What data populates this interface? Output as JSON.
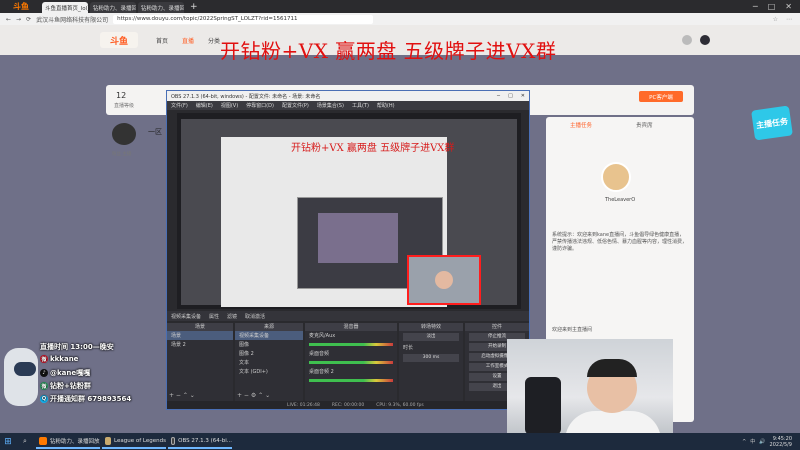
{
  "browser": {
    "brand": "斗鱼",
    "tabs": [
      {
        "label": "斗鱼直播首页_lol直播_英雄联盟直播",
        "active": true
      },
      {
        "label": "钻粉助力、录播回放",
        "active": false
      },
      {
        "label": "钻粉助力、录播回放、斗鱼直播平台",
        "active": false
      }
    ],
    "new_tab": "+",
    "window_controls": [
      "─",
      "□",
      "✕"
    ],
    "nav_buttons": [
      "←",
      "→",
      "⟳"
    ],
    "site_label": "武汉斗鱼网络科技有限公司",
    "url": "https://www.douyu.com/topic/2022SpringST_LOLZT?rid=1561711",
    "toolbar_icons": [
      "☆",
      "⋯"
    ]
  },
  "site": {
    "logo": "斗鱼",
    "nav": [
      "首页",
      "直播",
      "分类"
    ],
    "active_nav": "直播",
    "overlay_title": "开钻粉+VX 赢两盘 五级牌子进VX群",
    "room_level": "12",
    "room_level_label": "直播等级",
    "pc_button": "PC客户端",
    "host_name": "一区",
    "host_badges": "粉丝 主播",
    "side_tabs": [
      "主播任务",
      "贵宾席"
    ],
    "side_host_name": "TheLeaverO",
    "side_chat": "系统提示：欢迎来到kane直播间，斗鱼倡导绿色健康直播，严禁传播违法违规、低俗色情、暴力血腥等内容，理性消费，谨防诈骗。",
    "side_welcome": "欢迎来到主直播间",
    "badge": "主播任务"
  },
  "obs": {
    "title": "OBS 27.1.3 (64-bit, windows) - 配置文件: 未命名 - 场景: 未命名",
    "menu": [
      "文件(F)",
      "编辑(E)",
      "视图(V)",
      "停靠窗口(D)",
      "配置文件(P)",
      "场景集合(S)",
      "工具(T)",
      "帮助(H)"
    ],
    "nested_title": "开钻粉+VX 赢两盘 五级牌子进VX群",
    "source_bar": [
      "视频采集设备",
      "属性",
      "滤镜",
      "取消激活"
    ],
    "docks": {
      "scenes": {
        "header": "场景",
        "items": [
          "场景",
          "场景 2"
        ]
      },
      "sources": {
        "header": "来源",
        "items": [
          "视频采集设备",
          "图像",
          "图像 2",
          "文本",
          "文本 (GDI+)"
        ]
      },
      "mixer": {
        "header": "混音器",
        "items": [
          "麦克风/Aux",
          "桌面音频",
          "桌面音频 2"
        ],
        "values": [
          "0.0 dB",
          "0.0 dB",
          "0.0 dB"
        ]
      },
      "transitions": {
        "header": "转场特效",
        "items": [
          "淡出",
          "时长",
          "300 ms"
        ]
      },
      "controls": {
        "header": "控件",
        "items": [
          "停止推流",
          "开始录制",
          "启动虚拟摄像机",
          "工作室模式",
          "设置",
          "退出"
        ]
      }
    },
    "status": [
      "LIVE: 01:26:48",
      "REC: 00:00:00",
      "CPU: 9.3%, 60.00 fps"
    ]
  },
  "social": {
    "lines": [
      {
        "icon": "live-icon",
        "text": "直播时间 13:00—晚安",
        "color": "#ff8a00"
      },
      {
        "icon": "weibo-icon",
        "text": "kkkane",
        "color": "#e6162d"
      },
      {
        "icon": "douyin-icon",
        "text": "@kane嘎嘎",
        "color": "#111111"
      },
      {
        "icon": "wechat-icon",
        "text": "钻粉+钻粉群",
        "color": "#2aae67"
      },
      {
        "icon": "qq-icon",
        "text": "开播通知群 679893564",
        "color": "#12b7f5"
      }
    ]
  },
  "taskbar": {
    "apps": [
      {
        "label": "钻粉助力、录播回放",
        "color": "#ff7a00"
      },
      {
        "label": "League of Legends",
        "color": "#c8aa6e"
      },
      {
        "label": "OBS 27.1.3 (64-bi...",
        "color": "#444444"
      }
    ],
    "tray_icons": [
      "^",
      "中",
      "🔊"
    ],
    "time": "9:45:20",
    "date": "2022/5/9"
  },
  "colors": {
    "accent": "#ff5d23",
    "overlay_red": "#e11010",
    "obs_dark": "#2a2a2e"
  }
}
